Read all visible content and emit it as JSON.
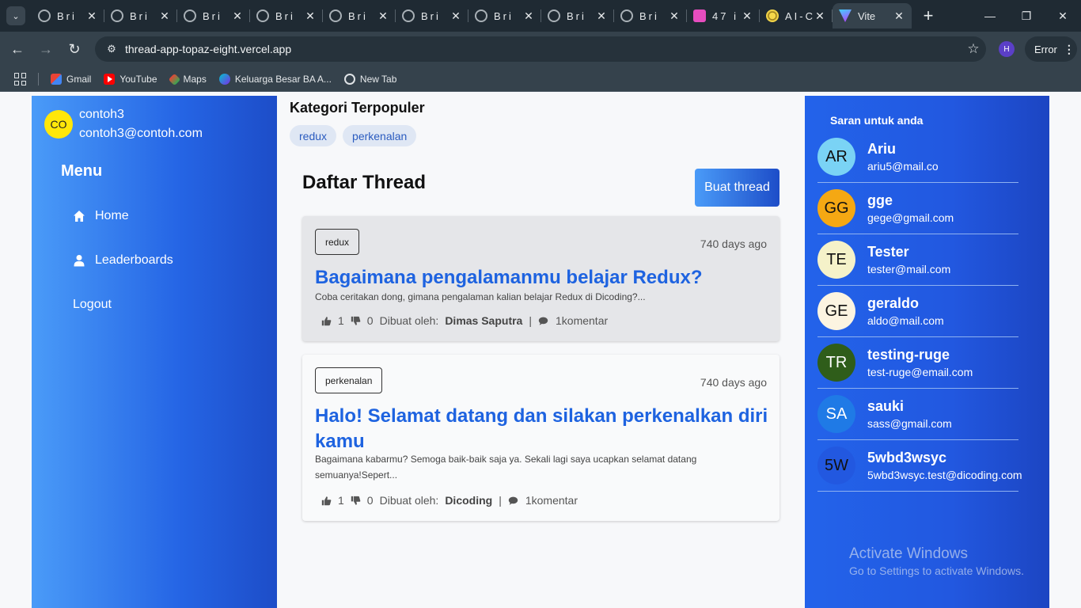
{
  "browser": {
    "tabs": [
      {
        "title": "Bri",
        "icon": "globe-icon"
      },
      {
        "title": "Bri",
        "icon": "globe-icon"
      },
      {
        "title": "Bri",
        "icon": "globe-icon"
      },
      {
        "title": "Bri",
        "icon": "globe-icon"
      },
      {
        "title": "Bri",
        "icon": "globe-icon"
      },
      {
        "title": "Bri",
        "icon": "globe-icon"
      },
      {
        "title": "Bri",
        "icon": "globe-icon"
      },
      {
        "title": "Bri",
        "icon": "globe-icon"
      },
      {
        "title": "Bri",
        "icon": "globe-icon"
      },
      {
        "title": "47 i",
        "icon": "pink-app-icon"
      },
      {
        "title": "AI-C",
        "icon": "sun-icon"
      },
      {
        "title": "Vite",
        "icon": "vite-icon",
        "active": true
      }
    ],
    "url": "thread-app-topaz-eight.vercel.app",
    "profile_initial": "H",
    "error_label": "Error",
    "bookmarks": [
      {
        "label": "Gmail",
        "icon": "gmail-icon"
      },
      {
        "label": "YouTube",
        "icon": "youtube-icon"
      },
      {
        "label": "Maps",
        "icon": "maps-icon"
      },
      {
        "label": "Keluarga Besar BA A...",
        "icon": "canva-icon"
      },
      {
        "label": "New Tab",
        "icon": "globe-icon"
      }
    ]
  },
  "user": {
    "initials": "CO",
    "name": "contoh3",
    "email": "contoh3@contoh.com"
  },
  "menu": {
    "heading": "Menu",
    "items": [
      {
        "label": "Home",
        "icon": "home-icon"
      },
      {
        "label": "Leaderboards",
        "icon": "user-icon"
      },
      {
        "label": "Logout",
        "icon": ""
      }
    ]
  },
  "categories": {
    "heading": "Kategori Terpopuler",
    "items": [
      "redux",
      "perkenalan"
    ]
  },
  "threads_section": {
    "heading": "Daftar Thread",
    "create_label": "Buat thread",
    "threads": [
      {
        "category": "redux",
        "time": "740 days ago",
        "title": "Bagaimana pengalamanmu belajar Redux?",
        "body": "Coba ceritakan dong, gimana pengalaman kalian belajar Redux di Dicoding?...",
        "up_votes": "1",
        "down_votes": "0",
        "created_by_label": "Dibuat oleh:",
        "author": "Dimas Saputra",
        "separator": "|",
        "comments": "1komentar"
      },
      {
        "category": "perkenalan",
        "time": "740 days ago",
        "title": "Halo! Selamat datang dan silakan perkenalkan diri kamu",
        "body": "Bagaimana kabarmu? Semoga baik-baik saja ya. Sekali lagi saya ucapkan selamat datang semuanya!Sepert...",
        "up_votes": "1",
        "down_votes": "0",
        "created_by_label": "Dibuat oleh:",
        "author": "Dicoding",
        "separator": "|",
        "comments": "1komentar"
      }
    ]
  },
  "suggestions": {
    "heading": "Saran untuk anda",
    "users": [
      {
        "initials": "AR",
        "name": "Ariu",
        "email": "ariu5@mail.co",
        "color": "#7ad3f5"
      },
      {
        "initials": "GG",
        "name": "gge",
        "email": "gege@gmail.com",
        "color": "#f5a813"
      },
      {
        "initials": "TE",
        "name": "Tester",
        "email": "tester@mail.com",
        "color": "#f5f2c9"
      },
      {
        "initials": "GE",
        "name": "geraldo",
        "email": "aldo@mail.com",
        "color": "#fcf4e1"
      },
      {
        "initials": "TR",
        "name": "testing-ruge",
        "email": "test-ruge@email.com",
        "color": "#2f5d1a"
      },
      {
        "initials": "SA",
        "name": "sauki",
        "email": "sass@gmail.com",
        "color": "#1f7ae6"
      },
      {
        "initials": "5W",
        "name": "5wbd3wsyc",
        "email": "5wbd3wsyc.test@dicoding.com",
        "color": "#2258e0"
      }
    ]
  },
  "watermark": {
    "line1": "Activate Windows",
    "line2": "Go to Settings to activate Windows."
  }
}
